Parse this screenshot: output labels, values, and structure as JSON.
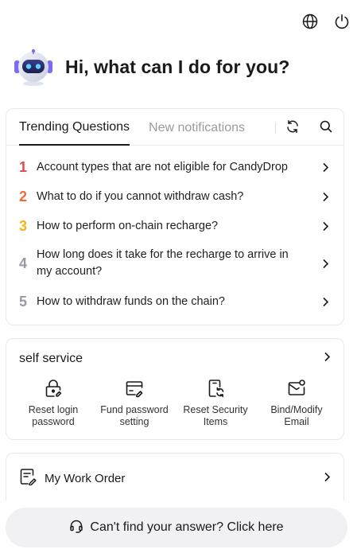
{
  "header": {
    "language_icon": "globe-icon",
    "power_icon": "power-icon"
  },
  "hero": {
    "greeting": "Hi, what can I do for you?",
    "avatar_icon": "robot-avatar"
  },
  "questions_card": {
    "tabs": [
      {
        "label": "Trending Questions",
        "active": true
      },
      {
        "label": "New notifications",
        "active": false
      }
    ],
    "refresh_icon": "refresh-icon",
    "search_icon": "search-icon",
    "items": [
      {
        "num": "1",
        "color": "#e5484d",
        "text": "Account types that are not eligible for CandyDrop"
      },
      {
        "num": "2",
        "color": "#f26b3a",
        "text": "What to do if you cannot withdraw cash?"
      },
      {
        "num": "3",
        "color": "#f5b316",
        "text": "How to perform on-chain recharge?"
      },
      {
        "num": "4",
        "color": "#9a9aa0",
        "text": "How long does it take for the recharge to arrive in my account?"
      },
      {
        "num": "5",
        "color": "#9a9aa0",
        "text": "How to withdraw funds on the chain?"
      }
    ]
  },
  "self_service": {
    "title": "self service",
    "items": [
      {
        "label": "Reset login password",
        "icon": "lock-reset-icon"
      },
      {
        "label": "Fund password setting",
        "icon": "card-edit-icon"
      },
      {
        "label": "Reset Security Items",
        "icon": "device-refresh-icon"
      },
      {
        "label": "Bind/Modify Email",
        "icon": "email-icon"
      }
    ]
  },
  "work_order": {
    "label": "My Work Order",
    "icon": "work-order-icon"
  },
  "footer": {
    "label": "Can't find your answer? Click here",
    "icon": "headset-icon"
  }
}
